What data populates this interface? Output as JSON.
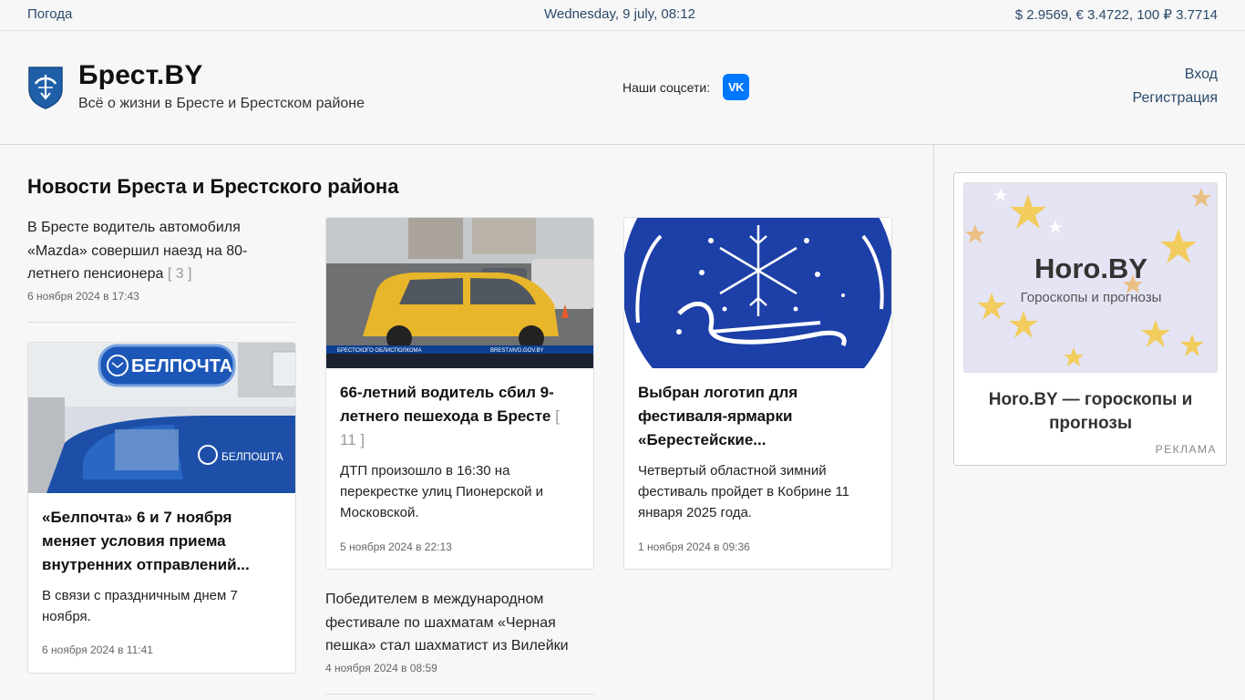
{
  "topbar": {
    "weather": "Погода",
    "date": "Wednesday, 9 july, 08:12",
    "rates": "$ 2.9569, € 3.4722, 100 ₽ 3.7714"
  },
  "header": {
    "site_name": "Брест.BY",
    "tagline": "Всё о жизни в Бресте и Брестском районе",
    "socials_label": "Наши соцсети:",
    "vk_label": "VK",
    "login": "Вход",
    "register": "Регистрация",
    "icons": {
      "logo": "brest-coat-of-arms-icon",
      "vk": "vk-icon"
    }
  },
  "main": {
    "section_title": "Новости Бреста и Брестского района",
    "news": [
      {
        "title": "В Бресте водитель автомобиля «Mazda» совершил наезд на 80-летнего пенсионера",
        "comments": "[ 3 ]",
        "date": "6 ноября 2024 в 17:43"
      },
      {
        "title": "«Белпочта» 6 и 7 ноября меняет условия приема внутренних отправлений...",
        "description": "В связи с праздничным днем 7 ноября.",
        "date": "6 ноября 2024 в 11:41",
        "image_text": "БЕЛПОЧТА"
      },
      {
        "title": "66-летний водитель сбил 9-летнего пешехода в Бресте",
        "comments": "[ 11 ]",
        "description": "ДТП произошло в 16:30 на перекрестке улиц Пионерской и Московской.",
        "date": "5 ноября 2024 в 22:13"
      },
      {
        "title": "Победителем в международном фестивале по шахматам «Черная пешка» стал шахматист из Вилейки",
        "date": "4 ноября 2024 в 08:59"
      },
      {
        "title": "Выбран логотип для фестиваля-ярмарки «Берестейские...",
        "description": "Четвертый областной зимний фестиваль пройдет в Кобрине 11 января 2025 года.",
        "date": "1 ноября 2024 в 09:36"
      }
    ]
  },
  "ad": {
    "brand": "Horo.BY",
    "subtitle": "Гороскопы и прогнозы",
    "title": "Horo.BY — гороскопы и прогнозы",
    "label": "РЕКЛАМА"
  },
  "colors": {
    "link": "#2b4a6b",
    "vk": "#0077ff",
    "accent_blue": "#1c3fa8",
    "taxi_yellow": "#e8b62a"
  }
}
